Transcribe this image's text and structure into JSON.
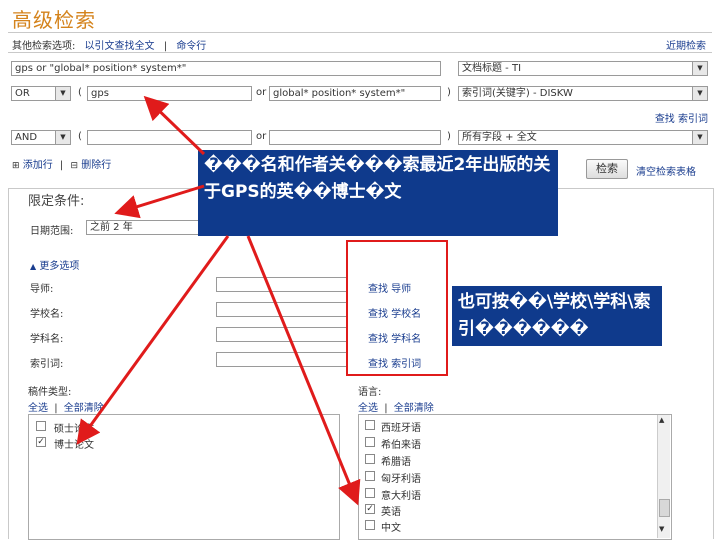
{
  "page_title": "高级检索",
  "other_options": {
    "label": "其他检索选项:",
    "link1": "以引文查找全文",
    "sep": "|",
    "link2": "命令行"
  },
  "recent_search": "近期检索",
  "rows": [
    {
      "bool": "",
      "paren_open": "",
      "value": "gps or \"global* position* system*\"",
      "op": "",
      "paren_close": "",
      "field": "文档标题 - TI"
    },
    {
      "bool": "OR",
      "paren_open": "(",
      "value": "gps",
      "op": "or",
      "value2": "global* position* system*\"",
      "paren_close": ")",
      "field": "索引词(关键字) - DISKW"
    },
    {
      "bool": "AND",
      "paren_open": "(",
      "value": "",
      "op": "or",
      "value2": "",
      "paren_close": ")",
      "field": "所有字段 + 全文"
    }
  ],
  "find_index_link": "查找 索引词",
  "add_row": "添加行",
  "delete_row": "删除行",
  "search_button": "检索",
  "clear_form": "清空检索表格",
  "limits_title": "限定条件:",
  "date_range_label": "日期范围:",
  "date_range_value": "之前 2 年",
  "more_options": "更多选项",
  "fields": [
    {
      "label": "导师:",
      "link": "查找 导师"
    },
    {
      "label": "学校名:",
      "link": "查找 学校名"
    },
    {
      "label": "学科名:",
      "link": "查找 学科名"
    },
    {
      "label": "索引词:",
      "link": "查找 索引词"
    }
  ],
  "doc_type": {
    "label": "稿件类型:",
    "select_all": "全选",
    "sep": "|",
    "clear_all": "全部清除",
    "items": [
      "硕士论文",
      "博士论文"
    ],
    "checked": [
      false,
      true
    ]
  },
  "language": {
    "label": "语言:",
    "select_all": "全选",
    "sep": "|",
    "clear_all": "全部清除",
    "items": [
      "西班牙语",
      "希伯来语",
      "希腊语",
      "匈牙利语",
      "意大利语",
      "英语",
      "中文"
    ],
    "checked": [
      false,
      false,
      false,
      false,
      false,
      true,
      false
    ]
  },
  "annotation1": "���名和作者关���索最近2年出版的关于GPS的英��博士�文",
  "annotation2": "也可按��\\学校\\学科\\索引������",
  "colors": {
    "title": "#d4831c",
    "link": "#1a3d8f",
    "annotation_bg": "#0f3a8c",
    "arrow": "#e01b1b"
  }
}
